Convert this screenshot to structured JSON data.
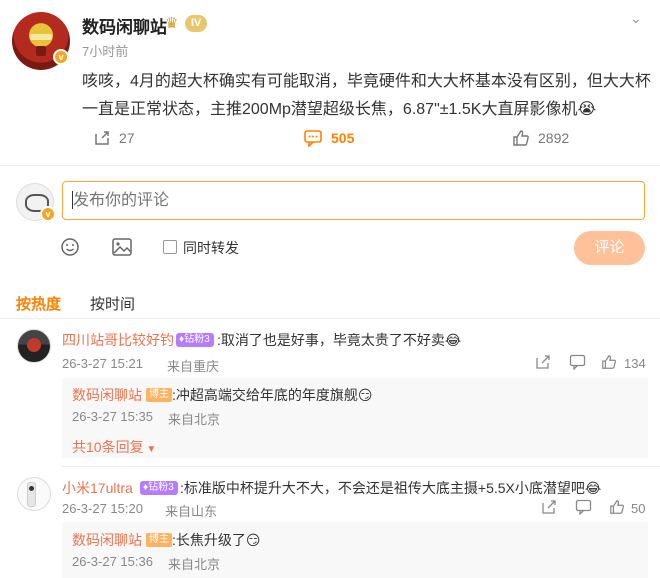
{
  "post": {
    "author": "数码闲聊站",
    "level_badge": "IV",
    "time": "7小时前",
    "body": "咳咳，4月的超大杯确实有可能取消，毕竟硬件和大大杯基本没有区别，但大大杯一直是正常状态，主推200Mp潜望超级长焦，6.87\"±1.5K大直屏影像机😭",
    "repost_count": "27",
    "comment_count": "505",
    "like_count": "2892",
    "icons": {
      "repost": "repost-icon",
      "comment": "comment-icon",
      "like": "like-icon",
      "more": "chevron-down-icon"
    }
  },
  "composer": {
    "placeholder": "发布你的评论",
    "repost_label": "同时转发",
    "submit_label": "评论",
    "icons": {
      "emoji": "emoji-icon",
      "image": "image-icon"
    }
  },
  "tabs": {
    "hot": "按热度",
    "time": "按时间"
  },
  "comments": [
    {
      "name": "四川站哥比较好钓",
      "badge": "钻粉3",
      "text": ":取消了也是好事，毕竟太贵了不好卖😂",
      "date": "26-3-27 15:21",
      "location": "来自重庆",
      "likes": "134",
      "reply": {
        "name": "数码闲聊站",
        "badge": "博主",
        "text": ":冲超高端交给年底的年度旗舰😏",
        "date": "26-3-27 15:35",
        "location": "来自北京"
      },
      "more_replies": "共10条回复"
    },
    {
      "name": "小米17ultra",
      "badge": "钻粉3",
      "text": ":标准版中杯提升大不大，不会还是祖传大底主摄+5.5X小底潜望吧😂",
      "date": "26-3-27 15:20",
      "location": "来自山东",
      "likes": "50",
      "reply": {
        "name": "数码闲聊站",
        "badge": "博主",
        "text": ":长焦升级了😏",
        "date": "26-3-27 15:36",
        "location": "来自北京"
      }
    }
  ],
  "colors": {
    "accent": "#ff8200",
    "username": "#eb7350",
    "submit_disabled": "#ffc09a",
    "input_border": "#ffa73d"
  }
}
